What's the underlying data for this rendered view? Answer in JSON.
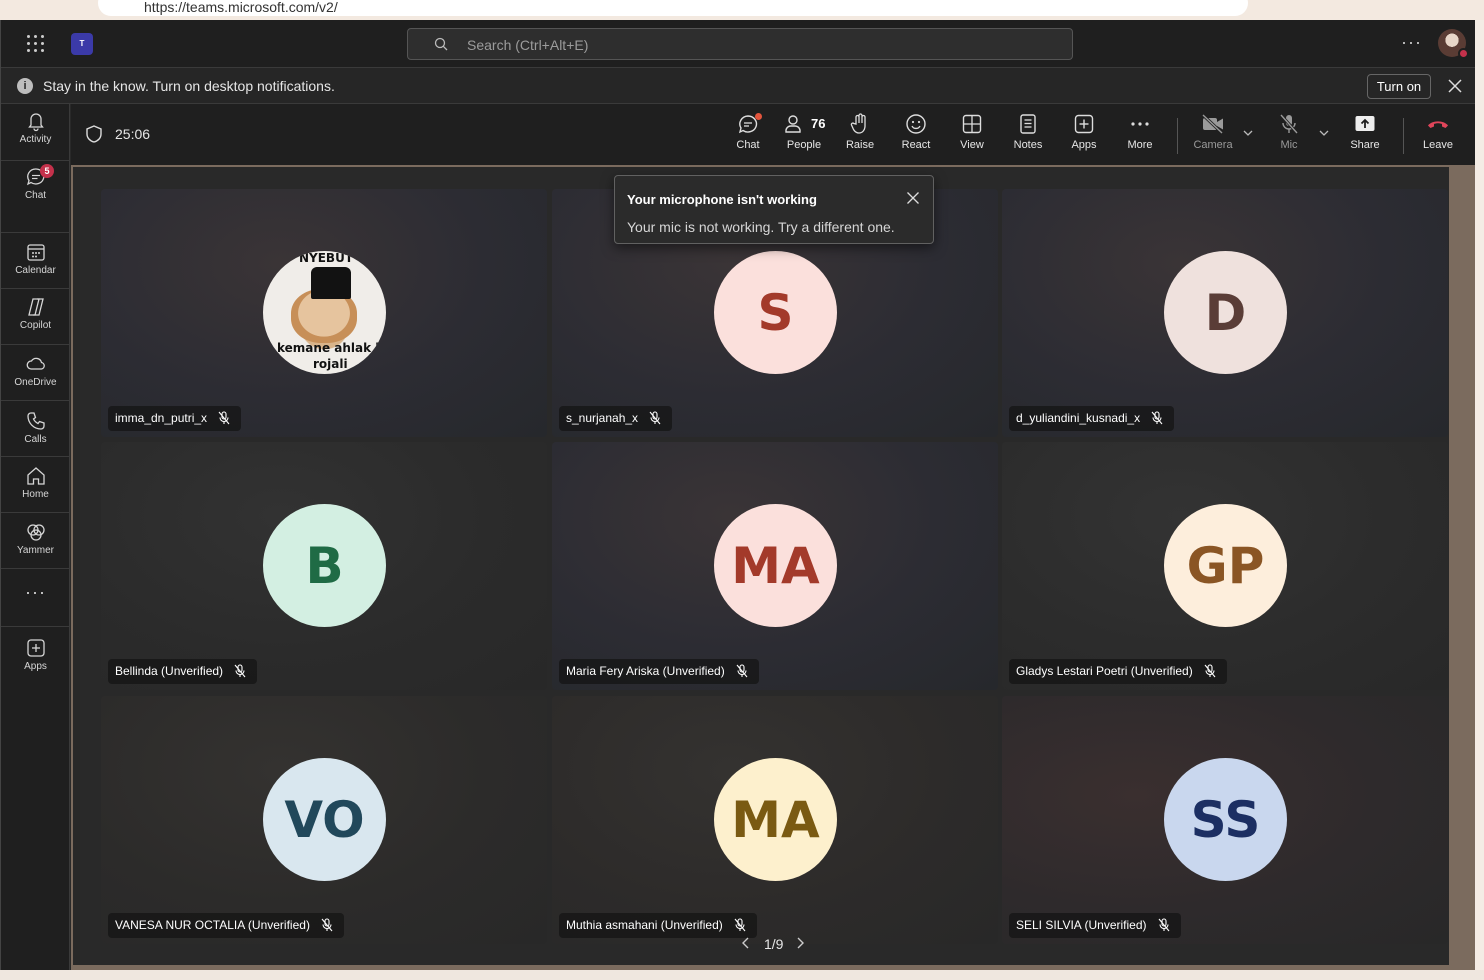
{
  "browser": {
    "url": "https://teams.microsoft.com/v2/"
  },
  "topbar": {
    "search_placeholder": "Search (Ctrl+Alt+E)"
  },
  "notification": {
    "text": "Stay in the know. Turn on desktop notifications.",
    "turn_on_label": "Turn on"
  },
  "rail": {
    "items": [
      {
        "label": "Activity",
        "icon": "bell-icon"
      },
      {
        "label": "Chat",
        "icon": "chat-icon",
        "badge": "5"
      },
      {
        "label": "Calendar",
        "icon": "calendar-icon"
      },
      {
        "label": "Copilot",
        "icon": "copilot-icon"
      },
      {
        "label": "OneDrive",
        "icon": "cloud-icon"
      },
      {
        "label": "Calls",
        "icon": "phone-icon"
      },
      {
        "label": "Home",
        "icon": "home-icon"
      },
      {
        "label": "Yammer",
        "icon": "yammer-icon"
      },
      {
        "label": "Apps",
        "icon": "add-app-icon"
      }
    ]
  },
  "callbar": {
    "timer": "25:06",
    "people_count": "76",
    "buttons": {
      "chat": "Chat",
      "people": "People",
      "raise": "Raise",
      "react": "React",
      "view": "View",
      "notes": "Notes",
      "apps": "Apps",
      "more": "More",
      "camera": "Camera",
      "mic": "Mic",
      "share": "Share",
      "leave": "Leave"
    }
  },
  "toast": {
    "title": "Your microphone isn't working",
    "body": "Your mic is not working. Try a different one."
  },
  "participants": [
    {
      "name": "imma_dn_putri_x",
      "initials": "",
      "photo_text": [
        "NYEBUT",
        "kemane ahlak lu",
        "rojali"
      ]
    },
    {
      "name": "s_nurjanah_x",
      "initials": "S",
      "bg": "#fbe0dc",
      "fg": "#a33a2a"
    },
    {
      "name": "d_yuliandini_kusnadi_x",
      "initials": "D",
      "bg": "#efe1dd",
      "fg": "#5a3d37"
    },
    {
      "name": "Bellinda (Unverified)",
      "initials": "B",
      "bg": "#d3efe2",
      "fg": "#1f6b45"
    },
    {
      "name": "Maria Fery Ariska (Unverified)",
      "initials": "MA",
      "bg": "#fbe0dc",
      "fg": "#a33a2a"
    },
    {
      "name": "Gladys Lestari Poetri (Unverified)",
      "initials": "GP",
      "bg": "#fdeedc",
      "fg": "#8a5524"
    },
    {
      "name": "VANESA NUR OCTALIA (Unverified)",
      "initials": "VO",
      "bg": "#d9e7ef",
      "fg": "#21485b"
    },
    {
      "name": "Muthia asmahani (Unverified)",
      "initials": "MA",
      "bg": "#fdf0cd",
      "fg": "#7a5a12"
    },
    {
      "name": "SELI SILVIA (Unverified)",
      "initials": "SS",
      "bg": "#c9d7ee",
      "fg": "#1c2f63"
    }
  ],
  "pager": {
    "text": "1/9"
  },
  "colors": {
    "leave": "#e0455a",
    "accent": "#5b5fc7",
    "badge": "#c4314b"
  }
}
